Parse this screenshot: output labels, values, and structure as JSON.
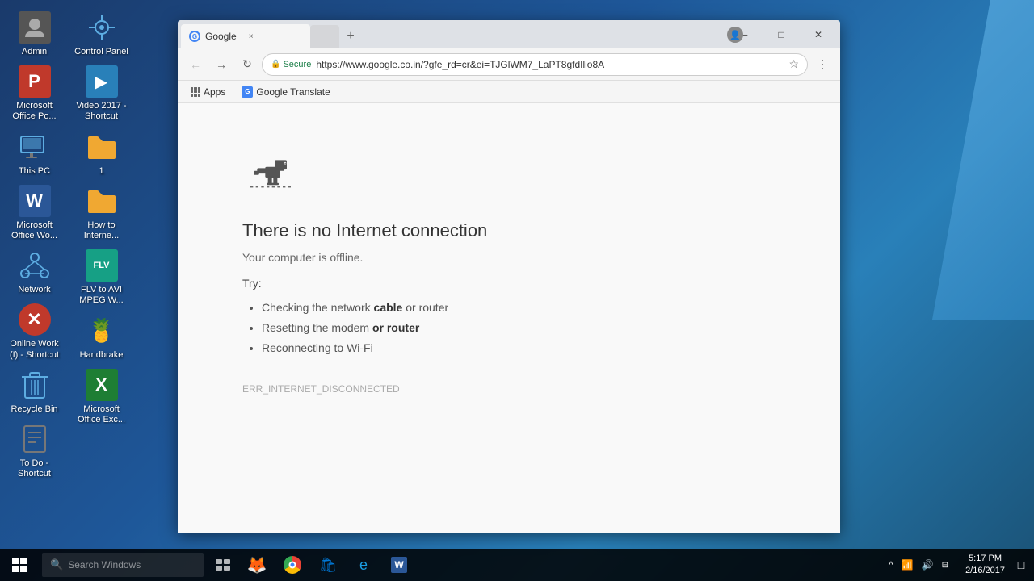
{
  "desktop": {
    "background": "Windows 10 default blue"
  },
  "desktop_icons": [
    {
      "id": "admin",
      "label": "Admin",
      "type": "user-folder",
      "row": 0,
      "col": 0
    },
    {
      "id": "ms-office-po",
      "label": "Microsoft\nOffice Po...",
      "type": "ms-office",
      "row": 1,
      "col": 0
    },
    {
      "id": "this-pc",
      "label": "This PC",
      "type": "computer",
      "row": 2,
      "col": 0
    },
    {
      "id": "ms-word",
      "label": "Microsoft\nOffice Wo...",
      "type": "ms-word",
      "row": 3,
      "col": 0
    },
    {
      "id": "network",
      "label": "Network",
      "type": "network",
      "row": 4,
      "col": 0
    },
    {
      "id": "online-work",
      "label": "Online Work\n(I) - Shortcut",
      "type": "shortcut-red",
      "row": 5,
      "col": 0
    },
    {
      "id": "recycle-bin",
      "label": "Recycle Bin",
      "type": "recycle",
      "row": 6,
      "col": 0
    },
    {
      "id": "todo",
      "label": "To Do -\nShortcut",
      "type": "todo",
      "row": 7,
      "col": 0
    },
    {
      "id": "control-panel",
      "label": "Control Panel",
      "type": "control-panel",
      "row": 0,
      "col": 1
    },
    {
      "id": "video-2017",
      "label": "Video 2017 -\nShortcut",
      "type": "video",
      "row": 1,
      "col": 1
    },
    {
      "id": "1",
      "label": "1",
      "type": "folder-txt",
      "row": 2,
      "col": 1
    },
    {
      "id": "how-to",
      "label": "How to\nInternet...",
      "type": "folder-txt2",
      "row": 3,
      "col": 1
    },
    {
      "id": "flv-avi",
      "label": "FLV to AVI\nMPEG W...",
      "type": "flv",
      "row": 4,
      "col": 1
    },
    {
      "id": "handbrake",
      "label": "Handbrake",
      "type": "handbrake",
      "row": 5,
      "col": 1
    },
    {
      "id": "ms-excel",
      "label": "Microsoft\nOffice Exc...",
      "type": "ms-excel",
      "row": 6,
      "col": 1
    }
  ],
  "browser": {
    "tab": {
      "favicon": "G",
      "title": "Google",
      "active": true
    },
    "second_tab": {
      "title": "",
      "active": false
    },
    "toolbar": {
      "back_disabled": true,
      "forward_disabled": false,
      "secure_label": "Secure",
      "url": "https://www.google.co.in/?gfe_rd=cr&ei=TJGlWM7_LaPT8gfdIlio8A",
      "bookmark_label": "Apps",
      "translate_label": "Google Translate"
    },
    "error_page": {
      "title": "There is no Internet connection",
      "subtitle": "Your computer is offline.",
      "try_label": "Try:",
      "suggestions": [
        "Checking the network cable or router",
        "Resetting the modem or router",
        "Reconnecting to Wi-Fi"
      ],
      "error_code": "ERR_INTERNET_DISCONNECTED"
    }
  },
  "taskbar": {
    "time": "5:17 PM",
    "date": "2/16/2017",
    "apps": [
      {
        "id": "start",
        "type": "windows-logo"
      },
      {
        "id": "search",
        "placeholder": "Search Windows"
      },
      {
        "id": "task-view",
        "type": "task-view"
      },
      {
        "id": "firefox",
        "type": "firefox"
      },
      {
        "id": "chrome",
        "type": "chrome"
      },
      {
        "id": "store",
        "type": "store"
      },
      {
        "id": "ie",
        "type": "ie"
      },
      {
        "id": "word-tb",
        "type": "word"
      }
    ]
  }
}
